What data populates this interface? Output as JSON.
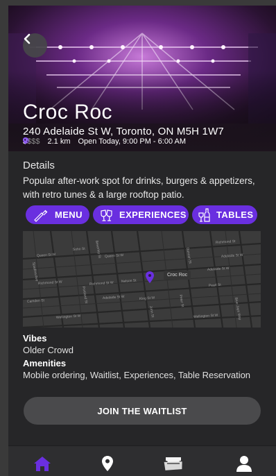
{
  "venue": {
    "name": "Croc Roc",
    "address": "240 Adelaide St W, Toronto, ON M5H 1W7",
    "price_active": "$",
    "price_inactive": "$$$",
    "distance": "2.1 km",
    "hours": "Open Today, 9:00 PM - 6:00 AM"
  },
  "details": {
    "title": "Details",
    "description": "Popular after-work spot for drinks, burgers & appetizers, with retro tunes & a large rooftop patio."
  },
  "actions": {
    "menu": "MENU",
    "experiences": "EXPERIENCES",
    "tables": "TABLES"
  },
  "map": {
    "pin_label": "Croc Roc",
    "streets": [
      "Queen St W",
      "Richmond St W",
      "Adelaide St W",
      "King St W",
      "Wellington St W",
      "Pearl St",
      "Nelson St",
      "Duncan St",
      "John St",
      "Widmer St",
      "Peter St",
      "Blue Jays Way",
      "Richmond St W",
      "Adelaide St W",
      "Portland St",
      "Spadina Ave",
      "Pearl St",
      "Camden St",
      "Bathurst St",
      "Soho St",
      "Beverley St",
      "Duncan St"
    ]
  },
  "vibes": {
    "heading": "Vibes",
    "value": "Older Crowd"
  },
  "amenities": {
    "heading": "Amenities",
    "value": "Mobile ordering, Waitlist, Experiences, Table Reservation"
  },
  "cta": {
    "label": "JOIN THE WAITLIST"
  },
  "colors": {
    "accent": "#6a2fe0",
    "background": "#262628"
  },
  "nav": {
    "items": [
      "home-icon",
      "location-icon",
      "tickets-icon",
      "profile-icon"
    ]
  }
}
